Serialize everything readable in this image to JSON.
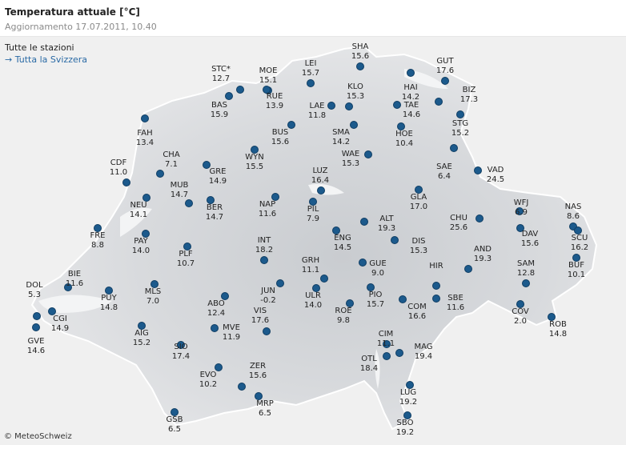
{
  "header": {
    "title": "Temperatura attuale [°C]",
    "updated": "Aggiornamento 17.07.2011, 10.40"
  },
  "map": {
    "all_stations_label": "Tutte le stazioni",
    "link_label": "→ Tutta la Svizzera",
    "copyright": "© MeteoSchweiz",
    "dot_color": "#1c5a8c",
    "stations": [
      {
        "code": "SHA",
        "temp": "15.6"
      },
      {
        "code": "GUT",
        "temp": "17.6"
      },
      {
        "code": "LEI",
        "temp": "15.7"
      },
      {
        "code": "MOE",
        "temp": "15.1"
      },
      {
        "code": "STC*",
        "temp": "12.7"
      },
      {
        "code": "HAI",
        "temp": "14.2"
      },
      {
        "code": "BIZ",
        "temp": "17.3"
      },
      {
        "code": "KLO",
        "temp": "15.3"
      },
      {
        "code": "RUE",
        "temp": "13.9"
      },
      {
        "code": "BAS",
        "temp": "15.9"
      },
      {
        "code": "TAE",
        "temp": "14.6"
      },
      {
        "code": "LAE",
        "temp": "11.8"
      },
      {
        "code": "STG",
        "temp": "15.2"
      },
      {
        "code": "FAH",
        "temp": "13.4"
      },
      {
        "code": "SMA",
        "temp": "14.2"
      },
      {
        "code": "HOE",
        "temp": "10.4"
      },
      {
        "code": "BUS",
        "temp": "15.6"
      },
      {
        "code": "WYN",
        "temp": "15.5"
      },
      {
        "code": "WAE",
        "temp": "15.3"
      },
      {
        "code": "SAE",
        "temp": "6.4"
      },
      {
        "code": "CHA",
        "temp": "7.1"
      },
      {
        "code": "CDF",
        "temp": "11.0"
      },
      {
        "code": "VAD",
        "temp": "24.5"
      },
      {
        "code": "GRE",
        "temp": "14.9"
      },
      {
        "code": "LUZ",
        "temp": "16.4"
      },
      {
        "code": "MUB",
        "temp": "14.7"
      },
      {
        "code": "GLA",
        "temp": "17.0"
      },
      {
        "code": "NEU",
        "temp": "14.1"
      },
      {
        "code": "NAP",
        "temp": "11.6"
      },
      {
        "code": "BER",
        "temp": "14.7"
      },
      {
        "code": "WFJ",
        "temp": "6.9"
      },
      {
        "code": "NAS",
        "temp": "8.6"
      },
      {
        "code": "PIL",
        "temp": "7.9"
      },
      {
        "code": "CHU",
        "temp": "25.6"
      },
      {
        "code": "ALT",
        "temp": "19.3"
      },
      {
        "code": "FRE",
        "temp": "8.8"
      },
      {
        "code": "DAV",
        "temp": "15.6"
      },
      {
        "code": "SCU",
        "temp": "16.2"
      },
      {
        "code": "ENG",
        "temp": "14.5"
      },
      {
        "code": "PAY",
        "temp": "14.0"
      },
      {
        "code": "INT",
        "temp": "18.2"
      },
      {
        "code": "DIS",
        "temp": "15.3"
      },
      {
        "code": "AND",
        "temp": "19.3"
      },
      {
        "code": "PLF",
        "temp": "10.7"
      },
      {
        "code": "GUE",
        "temp": "9.0"
      },
      {
        "code": "BUF",
        "temp": "10.1"
      },
      {
        "code": "SAM",
        "temp": "12.8"
      },
      {
        "code": "GRH",
        "temp": "11.1"
      },
      {
        "code": "BIE",
        "temp": "11.6"
      },
      {
        "code": "HIR",
        "temp": ""
      },
      {
        "code": "DOL",
        "temp": "5.3"
      },
      {
        "code": "PUY",
        "temp": "14.8"
      },
      {
        "code": "MLS",
        "temp": "7.0"
      },
      {
        "code": "JUN",
        "temp": "-0.2"
      },
      {
        "code": "ULR",
        "temp": "14.0"
      },
      {
        "code": "PIO",
        "temp": "15.7"
      },
      {
        "code": "SBE",
        "temp": "11.6"
      },
      {
        "code": "CGI",
        "temp": "14.9"
      },
      {
        "code": "ABO",
        "temp": "12.4"
      },
      {
        "code": "COM",
        "temp": "16.6"
      },
      {
        "code": "ROE",
        "temp": "9.8"
      },
      {
        "code": "COV",
        "temp": "2.0"
      },
      {
        "code": "VIS",
        "temp": "17.6"
      },
      {
        "code": "ROB",
        "temp": "14.8"
      },
      {
        "code": "AIG",
        "temp": "15.2"
      },
      {
        "code": "MVE",
        "temp": "11.9"
      },
      {
        "code": "CIM",
        "temp": "11.1"
      },
      {
        "code": "GVE",
        "temp": "14.6"
      },
      {
        "code": "SIO",
        "temp": "17.4"
      },
      {
        "code": "MAG",
        "temp": "19.4"
      },
      {
        "code": "OTL",
        "temp": "18.4"
      },
      {
        "code": "ZER",
        "temp": "15.6"
      },
      {
        "code": "EVO",
        "temp": "10.2"
      },
      {
        "code": "LUG",
        "temp": "19.2"
      },
      {
        "code": "MRP",
        "temp": "6.5"
      },
      {
        "code": "GSB",
        "temp": "6.5"
      },
      {
        "code": "SBO",
        "temp": "19.2"
      }
    ]
  }
}
